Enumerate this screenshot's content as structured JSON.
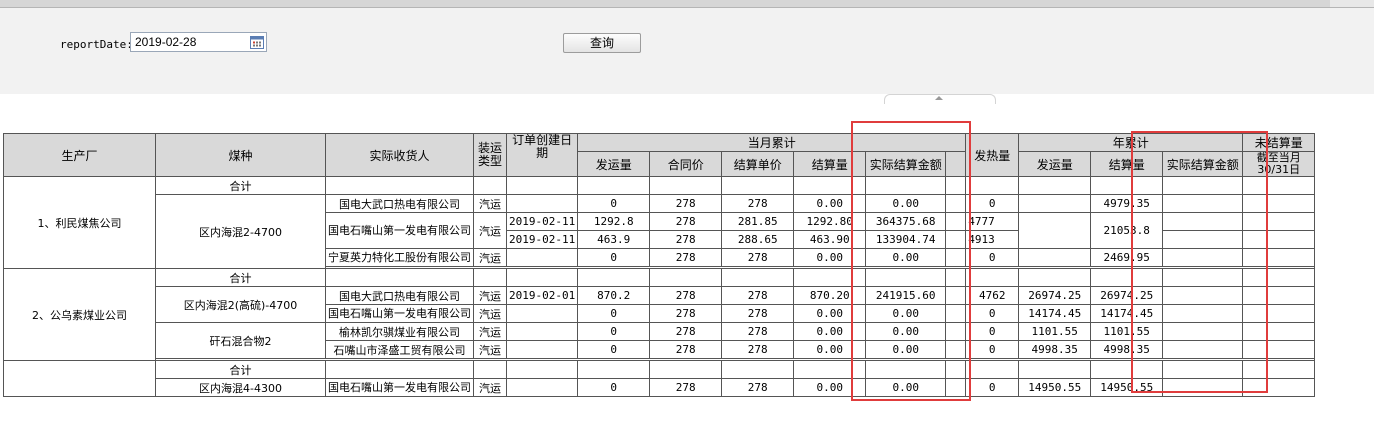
{
  "filter": {
    "report_date_label": "reportDate:",
    "report_date_value": "2019-02-28",
    "query_button": "查询"
  },
  "headers": {
    "factory": "生产厂",
    "coal_type": "煤种",
    "consignee": "实际收货人",
    "transport": "装运类型",
    "order_date": "订单创建日期",
    "month_group": "当月累计",
    "m_ship": "发运量",
    "m_contract": "合同价",
    "m_unit": "结算单价",
    "m_settle": "结算量",
    "m_amount": "实际结算金额",
    "heat": "发热量",
    "year_group": "年累计",
    "y_ship": "发运量",
    "y_settle": "结算量",
    "y_amount": "实际结算金额",
    "unsettled_group": "未结算量",
    "unsettled_cut": "截至当月30/31日"
  },
  "colors": {
    "header_bg": "#d9d9d9",
    "highlight": "#e03c3c",
    "filter_bg": "#f2f2f2"
  },
  "rows": {
    "g1_factory": "1、利民煤焦公司",
    "g1_total": "合计",
    "g1_coal": "区内海混2-4700",
    "g1_r1": {
      "consignee": "国电大武口热电有限公司",
      "transport": "汽运",
      "ship": "0",
      "contract": "278",
      "unit": "278",
      "settle": "0.00",
      "amount": "0.00",
      "heat": "0",
      "y_settle": "4979.35"
    },
    "g1_r2": {
      "consignee": "国电石嘴山第一发电有限公司",
      "transport": "汽运",
      "date": "2019-02-11",
      "ship": "1292.8",
      "contract": "278",
      "unit": "281.85",
      "settle": "1292.80",
      "amount": "364375.68",
      "heat": "4777",
      "y_settle": "21053.8"
    },
    "g1_r3": {
      "date": "2019-02-11",
      "ship": "463.9",
      "contract": "278",
      "unit": "288.65",
      "settle": "463.90",
      "amount": "133904.74",
      "heat": "4913"
    },
    "g1_r4": {
      "consignee": "宁夏英力特化工股份有限公司",
      "transport": "汽运",
      "ship": "0",
      "contract": "278",
      "unit": "278",
      "settle": "0.00",
      "amount": "0.00",
      "heat": "0",
      "y_settle": "2469.95"
    },
    "g2_factory": "2、公乌素煤业公司",
    "g2_total": "合计",
    "g2_coal_a": "区内海混2(高硫)-4700",
    "g2_coal_b": "矸石混合物2",
    "g2_r1": {
      "consignee": "国电大武口热电有限公司",
      "transport": "汽运",
      "date": "2019-02-01",
      "ship": "870.2",
      "contract": "278",
      "unit": "278",
      "settle": "870.20",
      "amount": "241915.60",
      "heat": "4762",
      "y_ship": "26974.25",
      "y_settle": "26974.25"
    },
    "g2_r2": {
      "consignee": "国电石嘴山第一发电有限公司",
      "transport": "汽运",
      "ship": "0",
      "contract": "278",
      "unit": "278",
      "settle": "0.00",
      "amount": "0.00",
      "heat": "0",
      "y_ship": "14174.45",
      "y_settle": "14174.45"
    },
    "g2_r3": {
      "consignee": "榆林凯尔骐煤业有限公司",
      "transport": "汽运",
      "ship": "0",
      "contract": "278",
      "unit": "278",
      "settle": "0.00",
      "amount": "0.00",
      "heat": "0",
      "y_ship": "1101.55",
      "y_settle": "1101.55"
    },
    "g2_r4": {
      "consignee": "石嘴山市泽盛工贸有限公司",
      "transport": "汽运",
      "ship": "0",
      "contract": "278",
      "unit": "278",
      "settle": "0.00",
      "amount": "0.00",
      "heat": "0",
      "y_ship": "4998.35",
      "y_settle": "4998.35"
    },
    "g3_total": "合计",
    "g3_coal": "区内海混4-4300",
    "g3_r1": {
      "consignee": "国电石嘴山第一发电有限公司",
      "transport": "汽运",
      "ship": "0",
      "contract": "278",
      "unit": "278",
      "settle": "0.00",
      "amount": "0.00",
      "heat": "0",
      "y_ship": "14950.55",
      "y_settle": "14950.55"
    }
  }
}
